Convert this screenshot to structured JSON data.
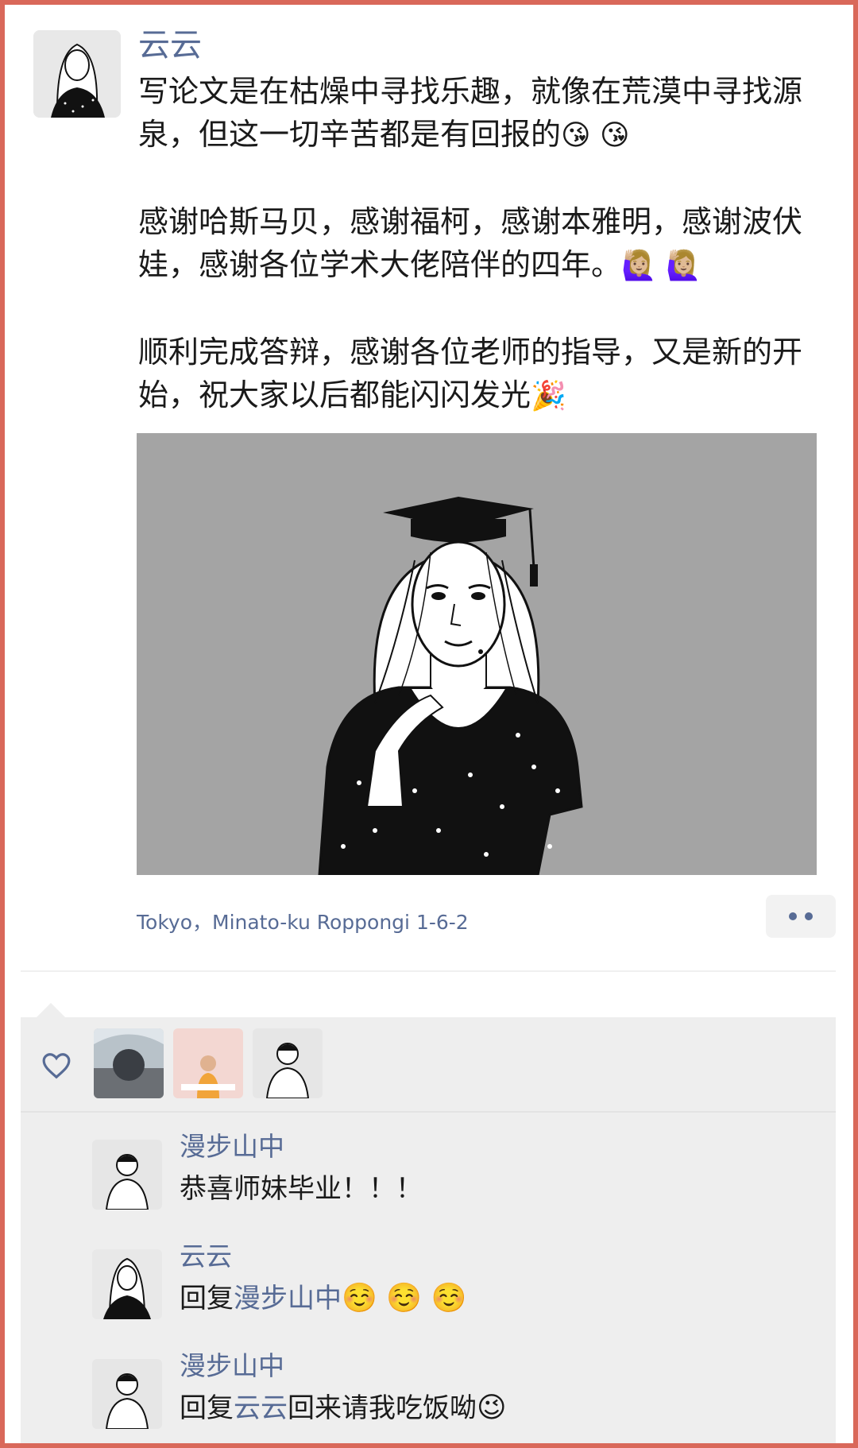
{
  "post": {
    "author_name": "云云",
    "paragraphs": [
      {
        "text": "写论文是在枯燥中寻找乐趣，就像在荒漠中寻找源泉，但这一切辛苦都是有回报的",
        "emoji": "😘 😘"
      },
      {
        "text": "感谢哈斯马贝，感谢福柯，感谢本雅明，感谢波伏娃，感谢各位学术大佬陪伴的四年。",
        "emoji": "🙋🏼‍♀️ 🙋🏼‍♀️"
      },
      {
        "text": "顺利完成答辩，感谢各位老师的指导，又是新的开始，祝大家以后都能闪闪发光",
        "emoji": "🎉"
      }
    ],
    "location": "Tokyo，Minato-ku Roppongi 1-6-2",
    "photo_background": "#a4a4a4"
  },
  "interactions": {
    "like_icon": "heart-icon",
    "likers": [
      "liker-1",
      "liker-2",
      "liker-3"
    ],
    "comments": [
      {
        "author": "漫步山中",
        "text": "恭喜师妹毕业！！！"
      },
      {
        "author": "云云",
        "reply_prefix": "回复",
        "reply_to": "漫步山中",
        "text": "",
        "emoji": "☺️ ☺️ ☺️"
      },
      {
        "author": "漫步山中",
        "reply_prefix": "回复",
        "reply_to": "云云",
        "text": "回来请我吃饭呦",
        "emoji": "😉"
      }
    ]
  },
  "colors": {
    "link": "#576b95",
    "frame": "#d9685a",
    "panel": "#eeeeee"
  }
}
